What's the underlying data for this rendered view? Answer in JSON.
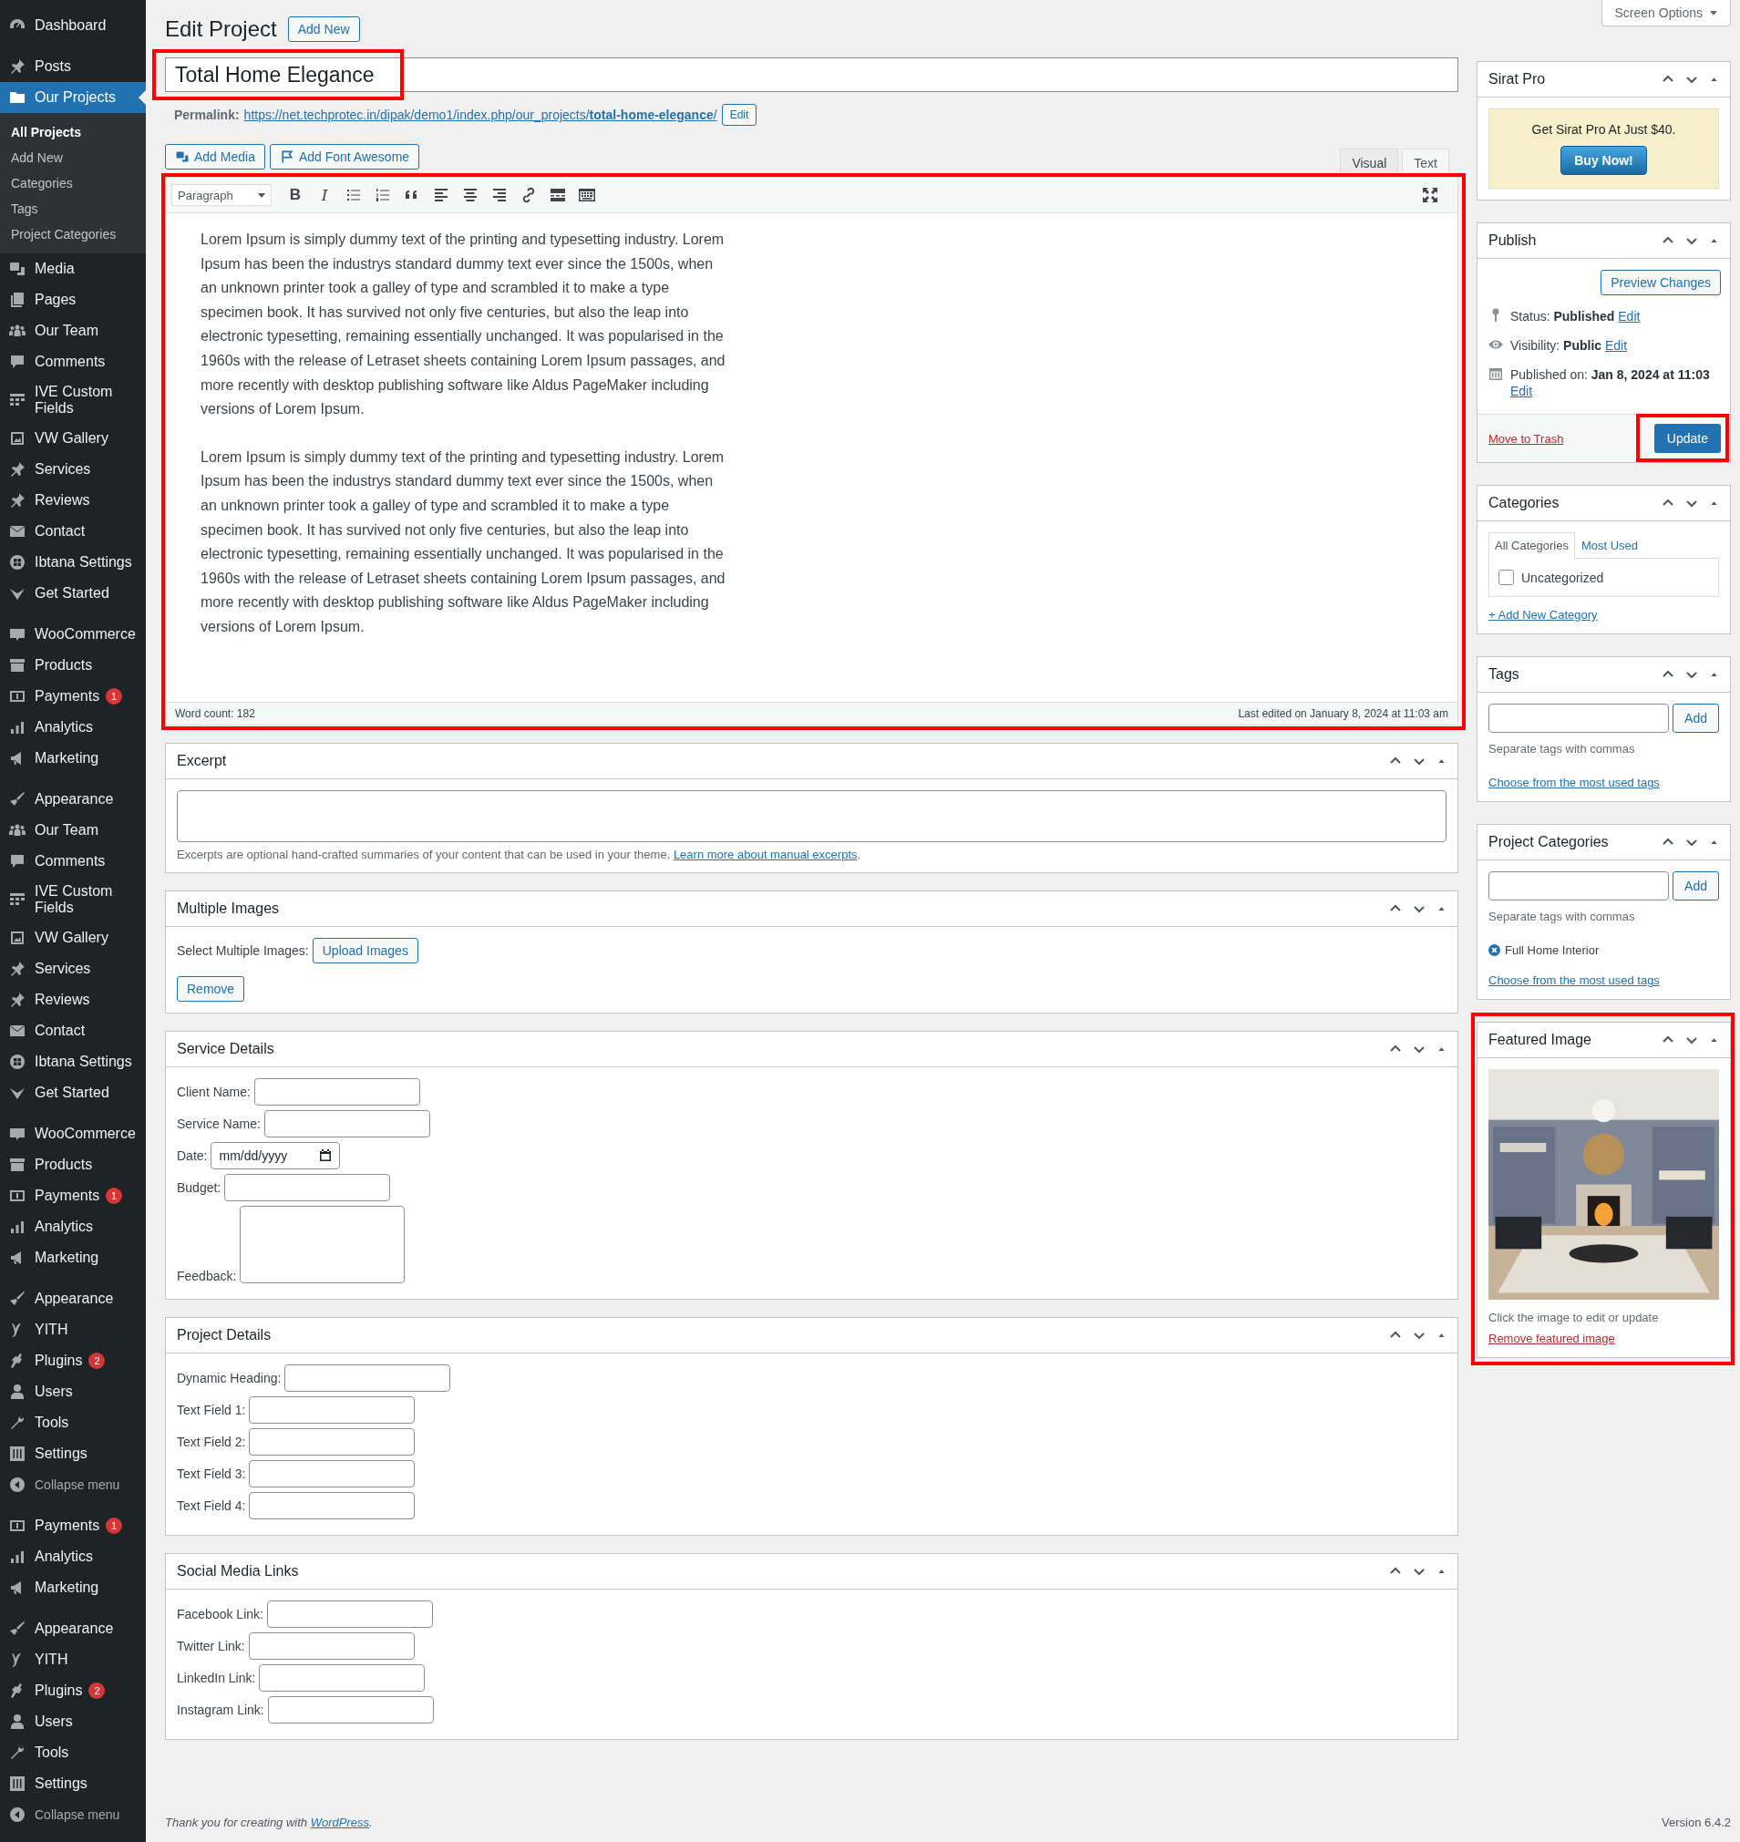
{
  "screen_options": "Screen Options",
  "sidebar": {
    "groups": [
      {
        "items": [
          {
            "label": "Dashboard",
            "kind": "gauge",
            "selected": false
          }
        ]
      },
      {
        "items": [
          {
            "label": "Posts",
            "kind": "pin",
            "selected": false
          },
          {
            "label": "Our Projects",
            "kind": "folder",
            "selected": true,
            "submenu": [
              {
                "label": "All Projects",
                "selected": true
              },
              {
                "label": "Add New",
                "selected": false
              },
              {
                "label": "Categories",
                "selected": false
              },
              {
                "label": "Tags",
                "selected": false
              },
              {
                "label": "Project Categories",
                "selected": false
              }
            ]
          },
          {
            "label": "Media",
            "kind": "media",
            "selected": false
          },
          {
            "label": "Pages",
            "kind": "pages",
            "selected": false
          },
          {
            "label": "Our Team",
            "kind": "people",
            "selected": false
          },
          {
            "label": "Comments",
            "kind": "comment",
            "selected": false
          },
          {
            "label": "IVE Custom Fields",
            "kind": "grid",
            "selected": false
          },
          {
            "label": "VW Gallery",
            "kind": "gallery",
            "selected": false
          },
          {
            "label": "Services",
            "kind": "pin",
            "selected": false
          },
          {
            "label": "Reviews",
            "kind": "pin",
            "selected": false
          },
          {
            "label": "Contact",
            "kind": "mail",
            "selected": false
          },
          {
            "label": "Ibtana Settings",
            "kind": "ring",
            "selected": false
          },
          {
            "label": "Get Started",
            "kind": "vee",
            "selected": false
          }
        ]
      },
      {
        "items": [
          {
            "label": "WooCommerce",
            "kind": "woo",
            "selected": false
          },
          {
            "label": "Products",
            "kind": "box",
            "selected": false
          },
          {
            "label": "Payments",
            "kind": "dollar",
            "selected": false,
            "badge": "1"
          },
          {
            "label": "Analytics",
            "kind": "bars",
            "selected": false
          },
          {
            "label": "Marketing",
            "kind": "megaphone",
            "selected": false
          }
        ]
      },
      {
        "items": [
          {
            "label": "Appearance",
            "kind": "brush",
            "selected": false
          },
          {
            "label": "Our Team",
            "kind": "people",
            "selected": false
          },
          {
            "label": "Comments",
            "kind": "comment",
            "selected": false
          },
          {
            "label": "IVE Custom Fields",
            "kind": "grid",
            "selected": false
          },
          {
            "label": "VW Gallery",
            "kind": "gallery",
            "selected": false
          },
          {
            "label": "Services",
            "kind": "pin",
            "selected": false
          },
          {
            "label": "Reviews",
            "kind": "pin",
            "selected": false
          },
          {
            "label": "Contact",
            "kind": "mail",
            "selected": false
          },
          {
            "label": "Ibtana Settings",
            "kind": "ring",
            "selected": false
          },
          {
            "label": "Get Started",
            "kind": "vee",
            "selected": false
          }
        ]
      },
      {
        "items": [
          {
            "label": "WooCommerce",
            "kind": "woo",
            "selected": false
          },
          {
            "label": "Products",
            "kind": "box",
            "selected": false
          },
          {
            "label": "Payments",
            "kind": "dollar",
            "selected": false,
            "badge": "1"
          },
          {
            "label": "Analytics",
            "kind": "bars",
            "selected": false
          },
          {
            "label": "Marketing",
            "kind": "megaphone",
            "selected": false
          }
        ]
      },
      {
        "items": [
          {
            "label": "Appearance",
            "kind": "brush",
            "selected": false
          },
          {
            "label": "YITH",
            "kind": "yith",
            "selected": false
          },
          {
            "label": "Plugins",
            "kind": "plugin",
            "selected": false,
            "badge": "2"
          },
          {
            "label": "Users",
            "kind": "user",
            "selected": false
          },
          {
            "label": "Tools",
            "kind": "wrench",
            "selected": false
          },
          {
            "label": "Settings",
            "kind": "sliders",
            "selected": false
          },
          {
            "label": "Collapse menu",
            "kind": "collapse",
            "selected": false
          }
        ]
      },
      {
        "items": [
          {
            "label": "Payments",
            "kind": "dollar",
            "selected": false,
            "badge": "1"
          },
          {
            "label": "Analytics",
            "kind": "bars",
            "selected": false
          },
          {
            "label": "Marketing",
            "kind": "megaphone",
            "selected": false
          }
        ]
      },
      {
        "items": [
          {
            "label": "Appearance",
            "kind": "brush",
            "selected": false
          },
          {
            "label": "YITH",
            "kind": "yith",
            "selected": false
          },
          {
            "label": "Plugins",
            "kind": "plugin",
            "selected": false,
            "badge": "2"
          },
          {
            "label": "Users",
            "kind": "user",
            "selected": false
          },
          {
            "label": "Tools",
            "kind": "wrench",
            "selected": false
          },
          {
            "label": "Settings",
            "kind": "sliders",
            "selected": false
          },
          {
            "label": "Collapse menu",
            "kind": "collapse",
            "selected": false
          }
        ]
      }
    ]
  },
  "header": {
    "title": "Edit Project",
    "add_new": "Add New"
  },
  "post_title": {
    "value": "Total Home Elegance",
    "highlighted": true
  },
  "permalink": {
    "label": "Permalink:",
    "url": "https://net.techprotec.in/dipak/demo1/index.php/our_projects/**total-home-elegance**/",
    "edit": "Edit"
  },
  "media_buttons": [
    {
      "label": "Add Media",
      "kind": "media"
    },
    {
      "label": "Add Font Awesome",
      "kind": "flag"
    }
  ],
  "editor": {
    "highlighted": true,
    "tabs": [
      {
        "label": "Visual",
        "selected": true
      },
      {
        "label": "Text",
        "selected": false
      }
    ],
    "format": "Paragraph",
    "toolbar": [
      {
        "kind": "bold",
        "label": "B"
      },
      {
        "kind": "italic",
        "label": "I"
      },
      {
        "kind": "bullets"
      },
      {
        "kind": "numbers"
      },
      {
        "kind": "quote"
      },
      {
        "kind": "align-left"
      },
      {
        "kind": "align-center"
      },
      {
        "kind": "align-right"
      },
      {
        "kind": "link"
      },
      {
        "kind": "more"
      },
      {
        "kind": "kitchen"
      }
    ],
    "paragraphs": [
      "Lorem Ipsum is simply dummy text of the printing and typesetting industry. Lorem Ipsum has been the industrys standard dummy text ever since the 1500s, when an unknown printer took a galley of type and scrambled it to make a type specimen book. It has survived not only five centuries, but also the leap into electronic typesetting, remaining essentially unchanged. It was popularised in the 1960s with the release of Letraset sheets containing Lorem Ipsum passages, and more recently with desktop publishing software like Aldus PageMaker including versions of Lorem Ipsum.",
      "Lorem Ipsum is simply dummy text of the printing and typesetting industry. Lorem Ipsum has been the industrys standard dummy text ever since the 1500s, when an unknown printer took a galley of type and scrambled it to make a type specimen book. It has survived not only five centuries, but also the leap into electronic typesetting, remaining essentially unchanged. It was popularised in the 1960s with the release of Letraset sheets containing Lorem Ipsum passages, and more recently with desktop publishing software like Aldus PageMaker including versions of Lorem Ipsum."
    ],
    "word_count": "Word count: 182",
    "last_edited": "Last edited on January 8, 2024 at 11:03 am"
  },
  "excerpt": {
    "title": "Excerpt",
    "hint": "Excerpts are optional hand-crafted summaries of your content that can be used in your theme.",
    "link": "Learn more about manual excerpts",
    "after": "."
  },
  "multiple_images": {
    "title": "Multiple Images",
    "label": "Select Multiple Images:",
    "upload": "Upload Images",
    "remove": "Remove"
  },
  "service_details": {
    "title": "Service Details",
    "fields": [
      {
        "label": "Client Name:",
        "kind": "text"
      },
      {
        "label": "Service Name:",
        "kind": "text"
      },
      {
        "label": "Date:",
        "kind": "date",
        "placeholder": "mm/dd/yyyy"
      },
      {
        "label": "Budget:",
        "kind": "text"
      },
      {
        "label": "Feedback:",
        "kind": "textarea"
      }
    ]
  },
  "project_details": {
    "title": "Project Details",
    "fields": [
      {
        "label": "Dynamic Heading:",
        "kind": "text"
      },
      {
        "label": "Text Field 1:",
        "kind": "text"
      },
      {
        "label": "Text Field 2:",
        "kind": "text"
      },
      {
        "label": "Text Field 3:",
        "kind": "text"
      },
      {
        "label": "Text Field 4:",
        "kind": "text"
      }
    ]
  },
  "social_links": {
    "title": "Social Media Links",
    "fields": [
      {
        "label": "Facebook Link:",
        "kind": "text"
      },
      {
        "label": "Twitter Link:",
        "kind": "text"
      },
      {
        "label": "LinkedIn Link:",
        "kind": "text"
      },
      {
        "label": "Instagram Link:",
        "kind": "text"
      }
    ]
  },
  "sirat_pro": {
    "title": "Sirat Pro",
    "promo": "Get Sirat Pro At Just $40.",
    "button": "Buy Now!"
  },
  "publish": {
    "title": "Publish",
    "preview": "Preview Changes",
    "rows": [
      {
        "kind": "status",
        "label": "Status:",
        "value": "Published",
        "edit": "Edit"
      },
      {
        "kind": "visibility",
        "label": "Visibility:",
        "value": "Public",
        "edit": "Edit"
      },
      {
        "kind": "date",
        "label": "Published on:",
        "value": "Jan 8, 2024 at 11:03",
        "edit": "Edit"
      }
    ],
    "trash": "Move to Trash",
    "update": {
      "label": "Update",
      "highlighted": true
    }
  },
  "categories": {
    "title": "Categories",
    "tabs": [
      {
        "label": "All Categories",
        "selected": true
      },
      {
        "label": "Most Used",
        "selected": false
      }
    ],
    "items": [
      {
        "label": "Uncategorized",
        "checked": false
      }
    ],
    "add_link": "+ Add New Category"
  },
  "tags": {
    "title": "Tags",
    "button": "Add",
    "hint": "Separate tags with commas",
    "link": "Choose from the most used tags"
  },
  "project_categories": {
    "title": "Project Categories",
    "button": "Add",
    "hint": "Separate tags with commas",
    "terms": [
      "Full Home Interior"
    ],
    "link": "Choose from the most used tags"
  },
  "featured_image": {
    "title": "Featured Image",
    "highlighted": true,
    "hint": "Click the image to edit or update",
    "remove": "Remove featured image"
  },
  "footer": {
    "credit": "Thank you for creating with",
    "link": "WordPress",
    "after": ".",
    "version": "Version 6.4.2"
  }
}
